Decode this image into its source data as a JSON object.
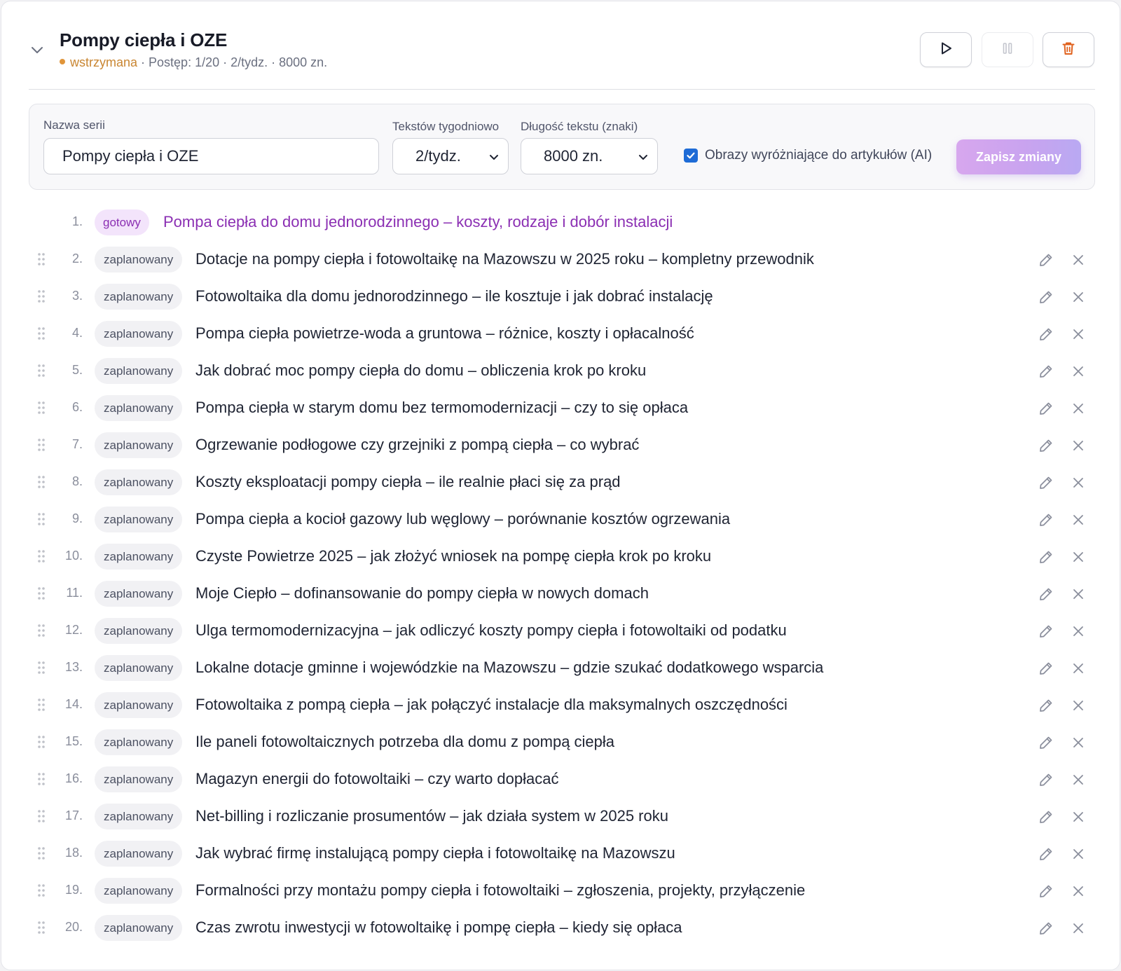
{
  "header": {
    "title": "Pompy ciepła i OZE",
    "status": "wstrzymana",
    "meta": " · Postęp: 1/20 · 2/tydz. · 8000 zn.",
    "status_color": "#c98632"
  },
  "form": {
    "name_label": "Nazwa serii",
    "name_value": "Pompy ciepła i OZE",
    "weekly_label": "Tekstów tygodniowo",
    "weekly_value": "2/tydz.",
    "length_label": "Długość tekstu (znaki)",
    "length_value": "8000 zn.",
    "images_label": "Obrazy wyróżniające do artykułów (AI)",
    "images_checked": true,
    "save_label": "Zapisz zmiany"
  },
  "colors": {
    "accent": "#8b2fb3",
    "checkbox": "#1e6bd6"
  },
  "items": [
    {
      "num": "1.",
      "status": "gotowy",
      "title": "Pompa ciepła do domu jednorodzinnego – koszty, rodzaje i dobór instalacji"
    },
    {
      "num": "2.",
      "status": "zaplanowany",
      "title": "Dotacje na pompy ciepła i fotowoltaikę na Mazowszu w 2025 roku – kompletny przewodnik"
    },
    {
      "num": "3.",
      "status": "zaplanowany",
      "title": "Fotowoltaika dla domu jednorodzinnego – ile kosztuje i jak dobrać instalację"
    },
    {
      "num": "4.",
      "status": "zaplanowany",
      "title": "Pompa ciepła powietrze-woda a gruntowa – różnice, koszty i opłacalność"
    },
    {
      "num": "5.",
      "status": "zaplanowany",
      "title": "Jak dobrać moc pompy ciepła do domu – obliczenia krok po kroku"
    },
    {
      "num": "6.",
      "status": "zaplanowany",
      "title": "Pompa ciepła w starym domu bez termomodernizacji – czy to się opłaca"
    },
    {
      "num": "7.",
      "status": "zaplanowany",
      "title": "Ogrzewanie podłogowe czy grzejniki z pompą ciepła – co wybrać"
    },
    {
      "num": "8.",
      "status": "zaplanowany",
      "title": "Koszty eksploatacji pompy ciepła – ile realnie płaci się za prąd"
    },
    {
      "num": "9.",
      "status": "zaplanowany",
      "title": "Pompa ciepła a kocioł gazowy lub węglowy – porównanie kosztów ogrzewania"
    },
    {
      "num": "10.",
      "status": "zaplanowany",
      "title": "Czyste Powietrze 2025 – jak złożyć wniosek na pompę ciepła krok po kroku"
    },
    {
      "num": "11.",
      "status": "zaplanowany",
      "title": "Moje Ciepło – dofinansowanie do pompy ciepła w nowych domach"
    },
    {
      "num": "12.",
      "status": "zaplanowany",
      "title": "Ulga termomodernizacyjna – jak odliczyć koszty pompy ciepła i fotowoltaiki od podatku"
    },
    {
      "num": "13.",
      "status": "zaplanowany",
      "title": "Lokalne dotacje gminne i wojewódzkie na Mazowszu – gdzie szukać dodatkowego wsparcia"
    },
    {
      "num": "14.",
      "status": "zaplanowany",
      "title": "Fotowoltaika z pompą ciepła – jak połączyć instalacje dla maksymalnych oszczędności"
    },
    {
      "num": "15.",
      "status": "zaplanowany",
      "title": "Ile paneli fotowoltaicznych potrzeba dla domu z pompą ciepła"
    },
    {
      "num": "16.",
      "status": "zaplanowany",
      "title": "Magazyn energii do fotowoltaiki – czy warto dopłacać"
    },
    {
      "num": "17.",
      "status": "zaplanowany",
      "title": "Net-billing i rozliczanie prosumentów – jak działa system w 2025 roku"
    },
    {
      "num": "18.",
      "status": "zaplanowany",
      "title": "Jak wybrać firmę instalującą pompy ciepła i fotowoltaikę na Mazowszu"
    },
    {
      "num": "19.",
      "status": "zaplanowany",
      "title": "Formalności przy montażu pompy ciepła i fotowoltaiki – zgłoszenia, projekty, przyłączenie"
    },
    {
      "num": "20.",
      "status": "zaplanowany",
      "title": "Czas zwrotu inwestycji w fotowoltaikę i pompę ciepła – kiedy się opłaca"
    }
  ]
}
